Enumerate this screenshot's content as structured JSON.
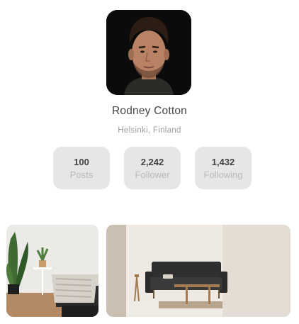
{
  "profile": {
    "name": "Rodney Cotton",
    "location": "Helsinki, Finland"
  },
  "stats": [
    {
      "value": "100",
      "label": "Posts"
    },
    {
      "value": "2,242",
      "label": "Follower"
    },
    {
      "value": "1,432",
      "label": "Following"
    }
  ],
  "icons": {
    "avatar": "profile-portrait",
    "photos": [
      "living-room-with-plant",
      "living-room-with-sofa"
    ]
  },
  "colors": {
    "card_bg": "#e6e6e6",
    "name_text": "#474747",
    "muted_text": "#9b9b9b"
  }
}
